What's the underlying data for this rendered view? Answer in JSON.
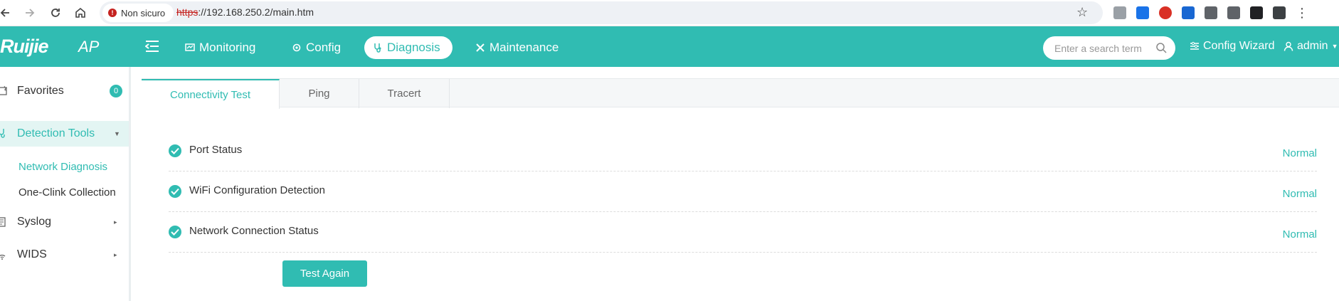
{
  "browser": {
    "security_label": "Non sicuro",
    "url_scheme": "https",
    "url_rest": "://192.168.250.2/main.htm"
  },
  "header": {
    "brand": "Ruijie",
    "brand_sub": "AP",
    "nav": [
      {
        "label": "Monitoring",
        "icon": "monitor-icon"
      },
      {
        "label": "Config",
        "icon": "gear-icon"
      },
      {
        "label": "Diagnosis",
        "icon": "stethoscope-icon",
        "active": true
      },
      {
        "label": "Maintenance",
        "icon": "tools-icon"
      }
    ],
    "search_placeholder": "Enter a search term",
    "config_wizard": "Config Wizard",
    "user": "admin",
    "accent_color": "#30bcb2"
  },
  "sidebar": {
    "favorites": {
      "label": "Favorites",
      "count": "0"
    },
    "detection_tools": {
      "label": "Detection Tools",
      "children": [
        {
          "label": "Network Diagnosis",
          "active": true
        },
        {
          "label": "One-Clink Collection"
        }
      ]
    },
    "syslog": {
      "label": "Syslog"
    },
    "wids": {
      "label": "WIDS"
    }
  },
  "main": {
    "tabs": [
      {
        "label": "Connectivity Test",
        "active": true
      },
      {
        "label": "Ping"
      },
      {
        "label": "Tracert"
      }
    ],
    "checks": [
      {
        "label": "Port Status",
        "status": "Normal"
      },
      {
        "label": "WiFi Configuration Detection",
        "status": "Normal"
      },
      {
        "label": "Network Connection Status",
        "status": "Normal"
      }
    ],
    "test_again_label": "Test Again"
  }
}
